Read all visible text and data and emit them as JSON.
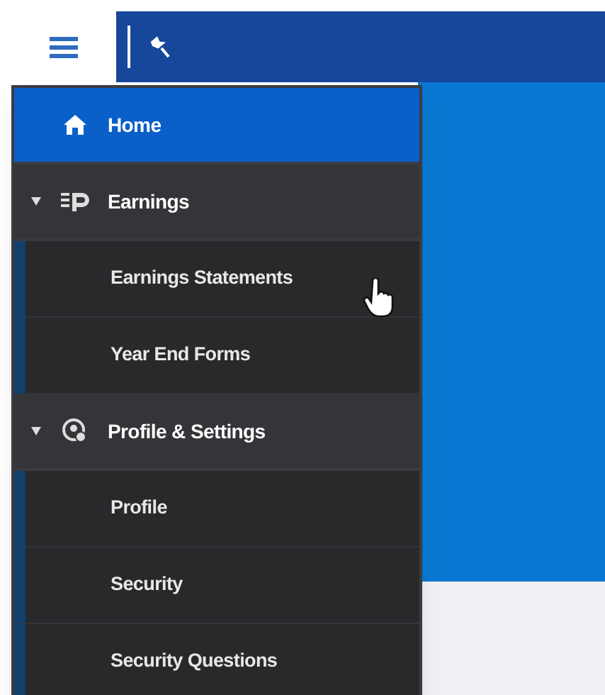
{
  "menu": [
    {
      "label": "Home",
      "kind": "link",
      "selected": true
    },
    {
      "label": "Earnings",
      "kind": "group",
      "selected": false,
      "expanded": true,
      "children": [
        {
          "label": "Earnings Statements",
          "selected": false,
          "hovered": true
        },
        {
          "label": "Year End Forms",
          "selected": false,
          "hovered": false
        }
      ]
    },
    {
      "label": "Profile & Settings",
      "kind": "group",
      "selected": false,
      "expanded": true,
      "children": [
        {
          "label": "Profile",
          "selected": false,
          "hovered": false
        },
        {
          "label": "Security",
          "selected": false,
          "hovered": false
        },
        {
          "label": "Security Questions",
          "selected": false,
          "hovered": false
        }
      ]
    }
  ]
}
